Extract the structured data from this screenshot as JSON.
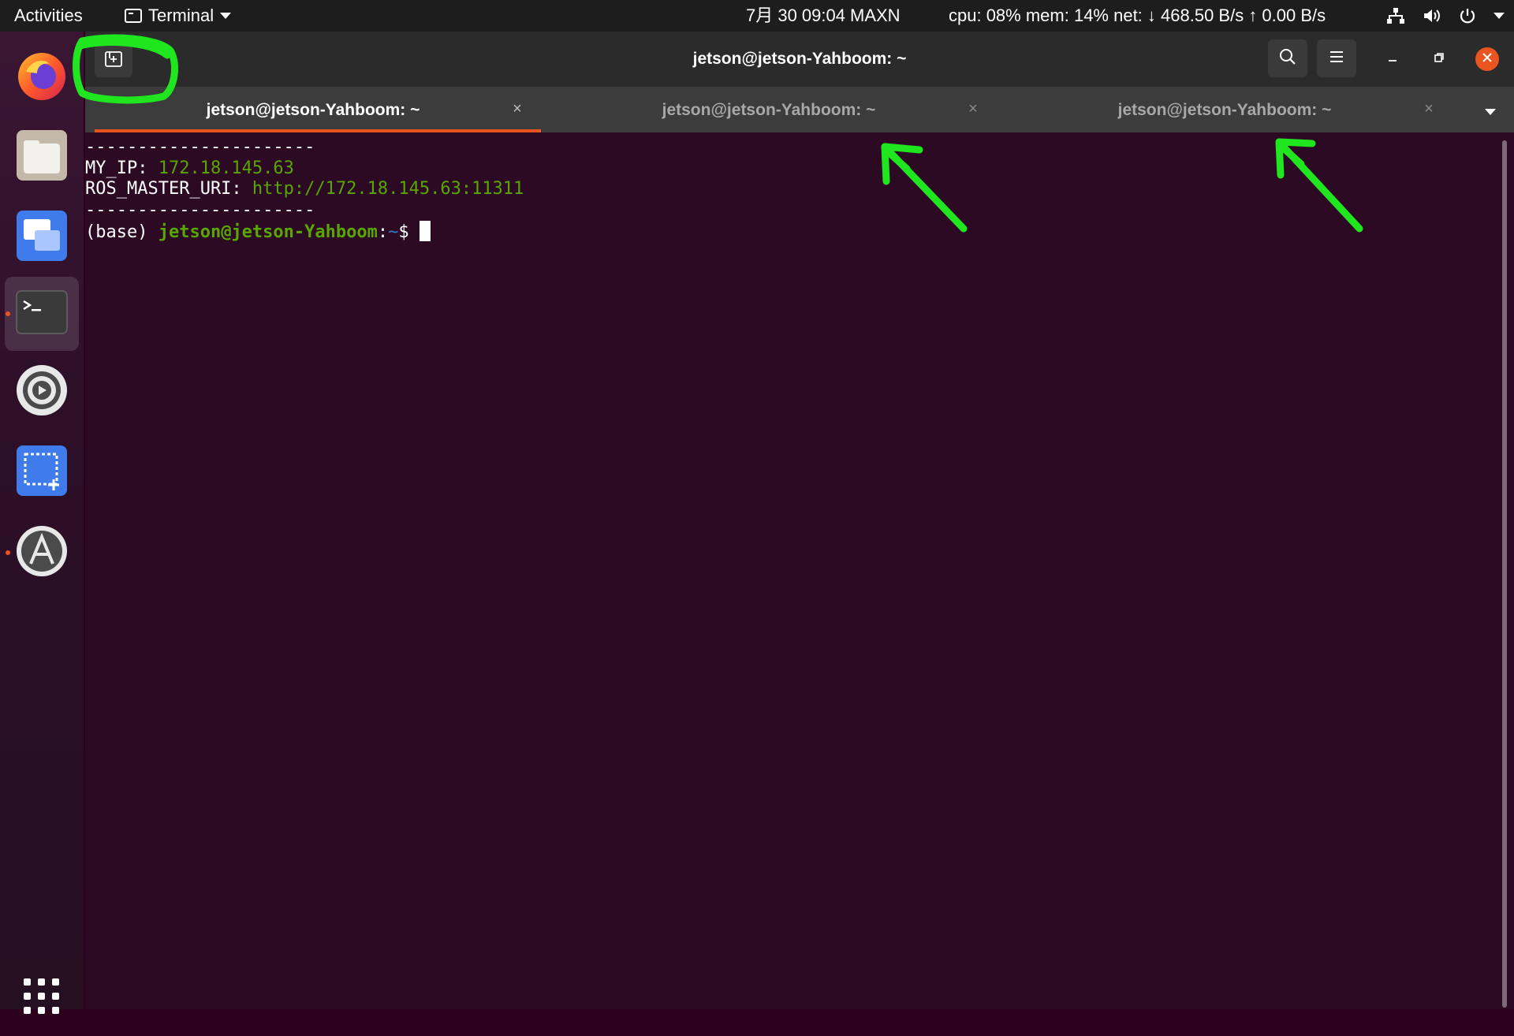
{
  "topbar": {
    "activities": "Activities",
    "app_name": "Terminal",
    "clock": "7月 30  09:04",
    "power_mode": "MAXN",
    "sysmon": "cpu: 08% mem: 14% net: ↓  468.50 B/s ↑   0.00 B/s",
    "tray_icons": [
      "network-icon",
      "volume-icon",
      "power-icon",
      "chevron-down-icon"
    ]
  },
  "dock": {
    "items": [
      "firefox-icon",
      "files-icon",
      "remote-desktop-icon",
      "terminal-icon",
      "settings-icon",
      "screenshot-icon",
      "software-updater-icon",
      "show-apps-icon"
    ]
  },
  "window": {
    "title": "jetson@jetson-Yahboom: ~",
    "tabs": [
      {
        "label": "jetson@jetson-Yahboom: ~",
        "active": true
      },
      {
        "label": "jetson@jetson-Yahboom: ~",
        "active": false
      },
      {
        "label": "jetson@jetson-Yahboom: ~",
        "active": false
      }
    ],
    "tab_close": "×"
  },
  "terminal": {
    "line1": "----------------------",
    "ip_label": "MY_IP: ",
    "ip_value": "172.18.145.63",
    "ros_label": "ROS_MASTER_URI: ",
    "ros_value": "http://172.18.145.63:11311",
    "line4": "----------------------",
    "env": "(base) ",
    "user_host": "jetson@jetson-Yahboom",
    "colon": ":",
    "path": "~",
    "prompt": "$ "
  },
  "colors": {
    "accent": "#e95420",
    "terminal_bg": "#2c0a24",
    "prompt_green": "#57a700",
    "annotation_green": "#1fe61f"
  }
}
